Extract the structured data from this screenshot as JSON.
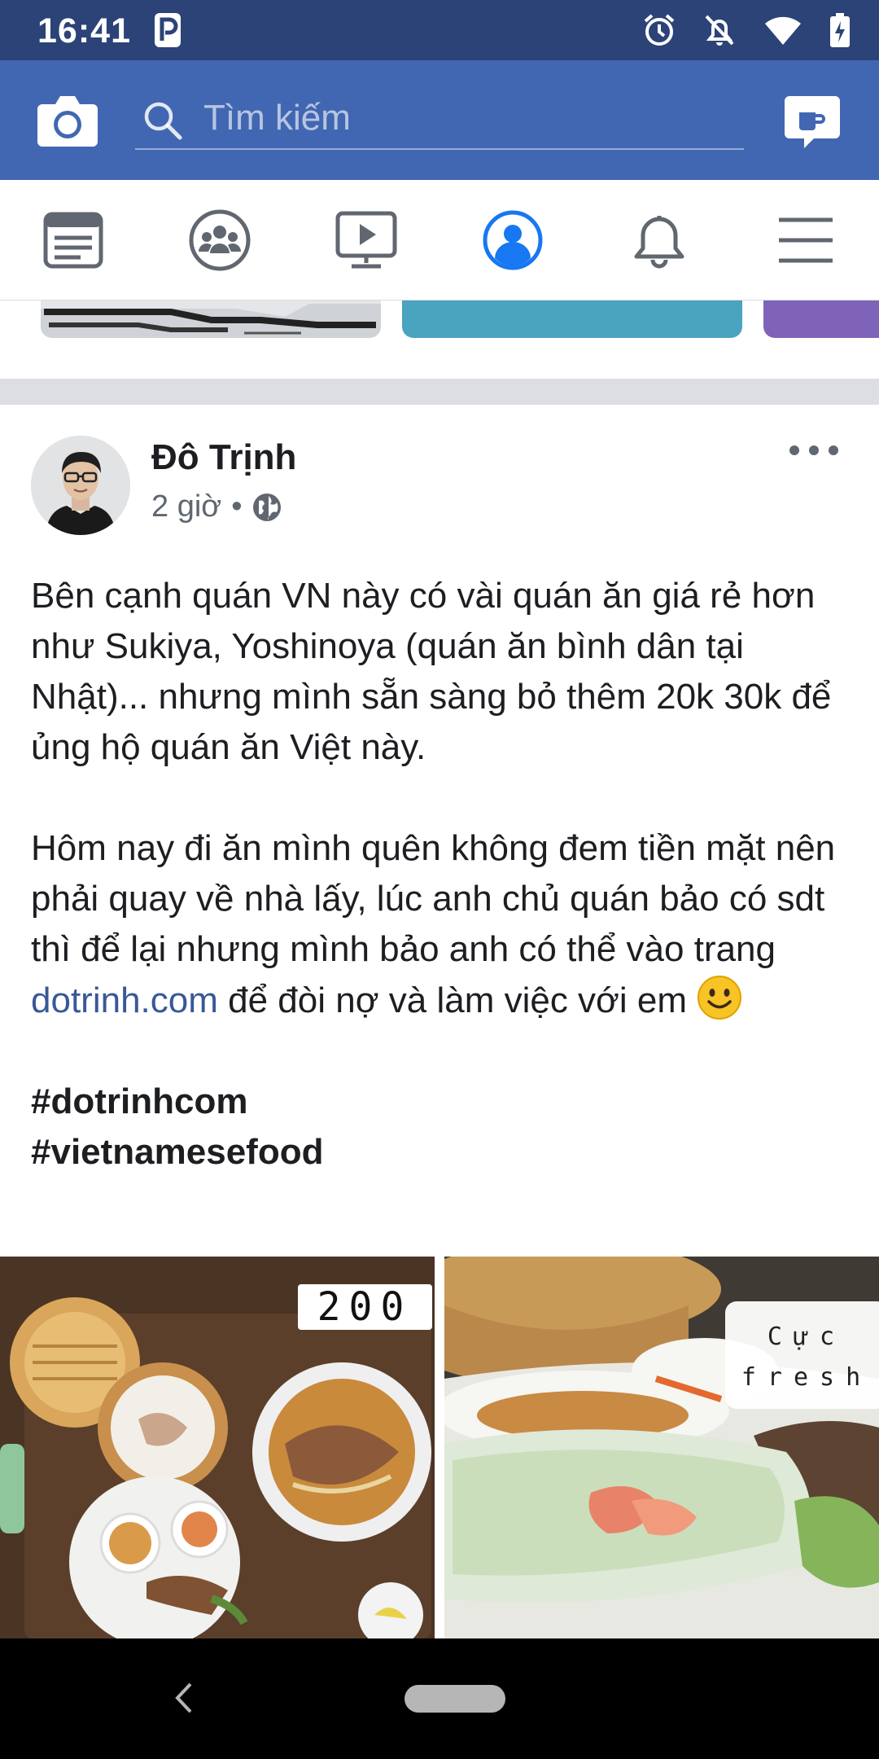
{
  "status_bar": {
    "time": "16:41",
    "icons": [
      "parking-app-icon",
      "alarm-icon",
      "notifications-off-icon",
      "wifi-icon",
      "battery-icon"
    ]
  },
  "app_bar": {
    "search_placeholder": "Tìm kiếm",
    "icons": [
      "camera-icon",
      "search-icon",
      "messenger-icon"
    ]
  },
  "tabs": [
    {
      "name": "news-feed",
      "icon": "news-feed-icon",
      "active": false
    },
    {
      "name": "groups",
      "icon": "groups-icon",
      "active": false
    },
    {
      "name": "watch",
      "icon": "watch-icon",
      "active": false
    },
    {
      "name": "profile",
      "icon": "profile-icon",
      "active": true
    },
    {
      "name": "notifications",
      "icon": "bell-icon",
      "active": false
    },
    {
      "name": "menu",
      "icon": "menu-icon",
      "active": false
    }
  ],
  "post": {
    "author": "Đô Trịnh",
    "time": "2 giờ",
    "separator": "•",
    "privacy_icon": "globe-icon",
    "paragraph_1": "Bên cạnh quán VN này có vài quán ăn giá rẻ hơn như Sukiya, Yoshinoya (quán ăn bình dân tại Nhật)... nhưng mình sẵn sàng bỏ thêm 20k 30k để ủng hộ quán ăn Việt này.",
    "paragraph_2_before_link": "Hôm nay đi ăn mình quên không đem tiền mặt nên phải quay về nhà lấy, lúc anh chủ quán bảo có sdt thì để lại nhưng mình bảo anh có thể vào trang ",
    "link": "dotrinh.com",
    "paragraph_2_after_link": " để đòi nợ và làm việc với em ",
    "hashtag_1": "#dotrinhcom",
    "hashtag_2": "#vietnamesefood",
    "photo_1_label": "200",
    "photo_2_label_line_1": "Cực",
    "photo_2_label_line_2": "fresh"
  },
  "colors": {
    "status_bar": "#2c4378",
    "app_bar": "#4267b2",
    "active_tab": "#1877f2",
    "inactive_tab": "#606770",
    "link": "#385898"
  }
}
